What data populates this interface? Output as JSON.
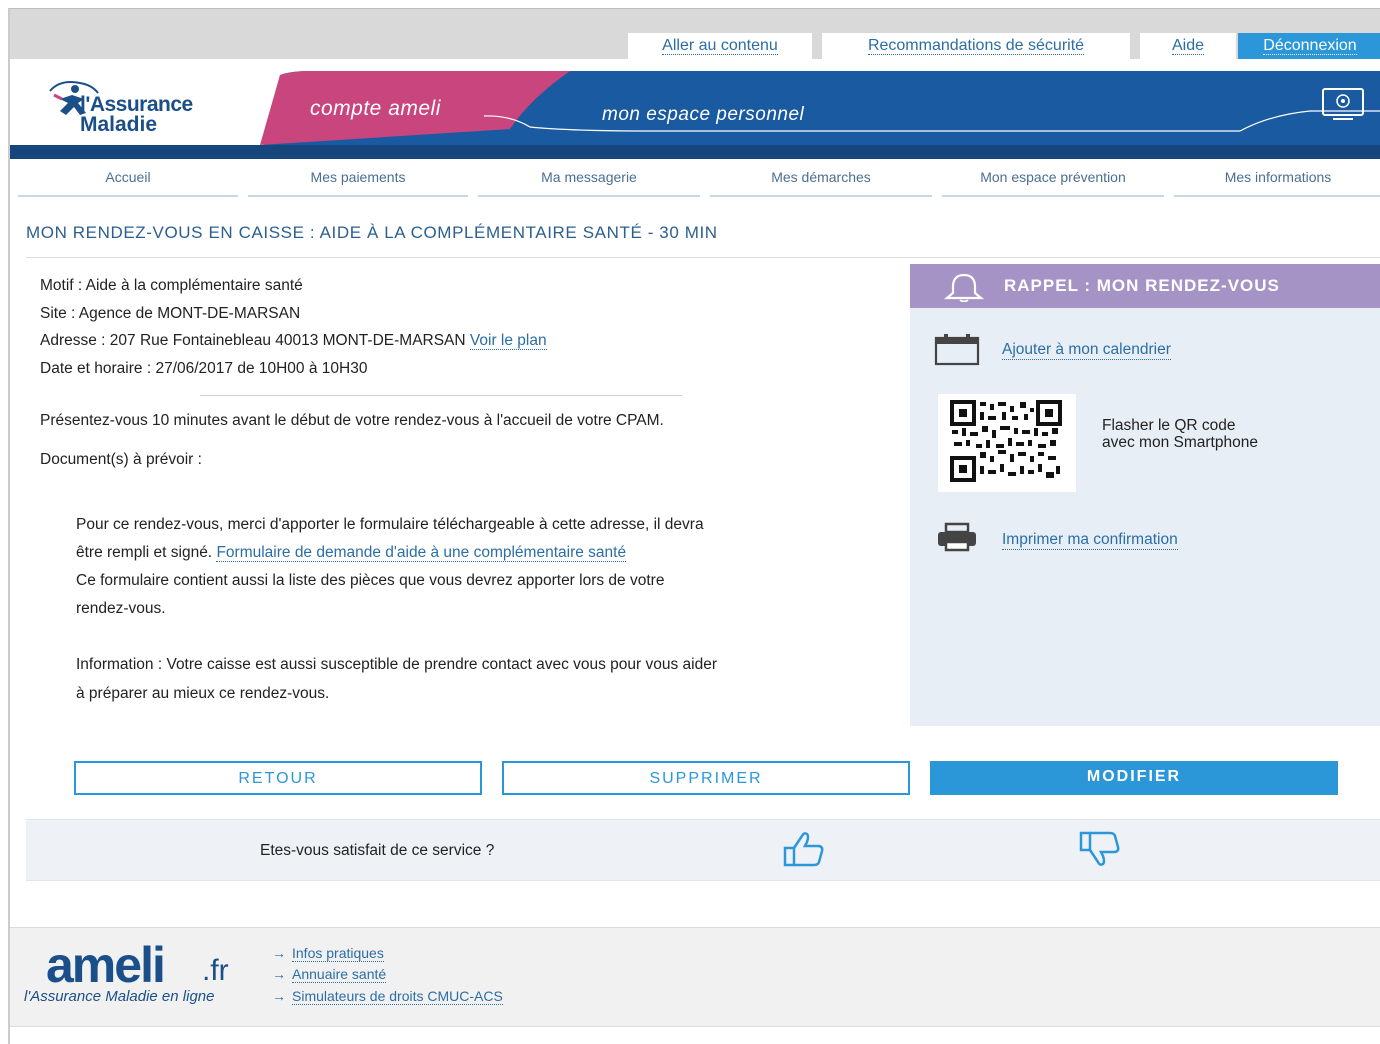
{
  "topbar": {
    "links": [
      {
        "label": "Aller au contenu"
      },
      {
        "label": "Recommandations de sécurité"
      },
      {
        "label": "Aide"
      },
      {
        "label": "Déconnexion"
      }
    ]
  },
  "header": {
    "logo_line1": "l'Assurance",
    "logo_line2": "Maladie",
    "compte": "compte ameli",
    "espace": "mon espace personnel",
    "colors": {
      "blue": "#1a5aa0",
      "pink": "#c9457e",
      "dark_blue": "#17467c"
    }
  },
  "nav": {
    "items": [
      {
        "label": "Accueil"
      },
      {
        "label": "Mes paiements"
      },
      {
        "label": "Ma messagerie"
      },
      {
        "label": "Mes démarches"
      },
      {
        "label": "Mon espace prévention"
      },
      {
        "label": "Mes informations"
      }
    ]
  },
  "page_title": "MON RENDEZ-VOUS EN CAISSE : AIDE À LA COMPLÉMENTAIRE SANTÉ - 30 MIN",
  "details": {
    "motif": "Motif : Aide à la complémentaire santé",
    "site": "Site : Agence de MONT-DE-MARSAN",
    "adresse": "Adresse :  207 Rue Fontainebleau 40013 MONT-DE-MARSAN",
    "voir_plan": "Voir le plan",
    "date": "Date et horaire : 27/06/2017 de 10H00 à 10H30"
  },
  "instructions": {
    "presentez": "Présentez-vous 10 minutes avant le début de votre rendez-vous à l'accueil de votre CPAM.",
    "documents": "Document(s) à prévoir :",
    "form_line1": "Pour ce rendez-vous, merci d'apporter le formulaire téléchargeable à cette adresse, il devra",
    "form_line2_prefix": "être rempli et signé.",
    "form_link": "Formulaire de demande d'aide à une complémentaire santé",
    "form_line3": "Ce formulaire contient aussi la liste des pièces que vous devrez apporter lors de votre",
    "form_line4": "rendez-vous.",
    "info_line1": "Information : Votre caisse est aussi susceptible de prendre contact avec vous pour vous aider",
    "info_line2": "à préparer au mieux ce rendez-vous."
  },
  "reminder": {
    "title": "RAPPEL : MON RENDEZ-VOUS",
    "calendar": "Ajouter à mon calendrier",
    "qr_line1": "Flasher le QR code",
    "qr_line2": "avec mon Smartphone",
    "print": "Imprimer ma confirmation"
  },
  "buttons": {
    "retour": "RETOUR",
    "supprimer": "SUPPRIMER",
    "modifier": "MODIFIER"
  },
  "satisfaction": {
    "question": "Etes-vous satisfait de ce service ?"
  },
  "footer": {
    "brand": "ameli",
    "brand_suffix": ".fr",
    "tagline": "l'Assurance Maladie en ligne",
    "links": [
      {
        "label": "Infos pratiques"
      },
      {
        "label": "Annuaire santé"
      },
      {
        "label": "Simulateurs de droits CMUC-ACS"
      }
    ]
  }
}
